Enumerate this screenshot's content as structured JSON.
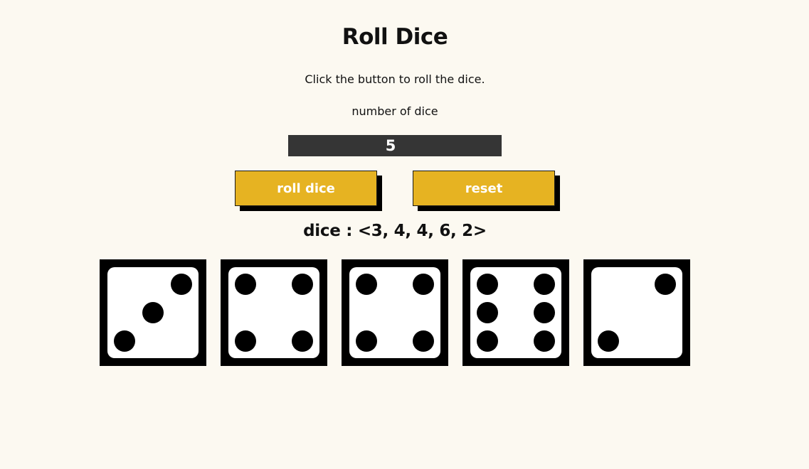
{
  "title": "Roll Dice",
  "subtitle": "Click the button to roll the dice.",
  "count_label": "number of dice",
  "count_value": "5",
  "buttons": {
    "roll_label": "roll dice",
    "reset_label": "reset"
  },
  "result_text": "dice : <3, 4, 4, 6, 2>",
  "dice": [
    3,
    4,
    4,
    6,
    2
  ],
  "colors": {
    "background": "#fcf9f1",
    "input_bg": "#353535",
    "button": "#e6b322",
    "shadow": "#000000"
  }
}
